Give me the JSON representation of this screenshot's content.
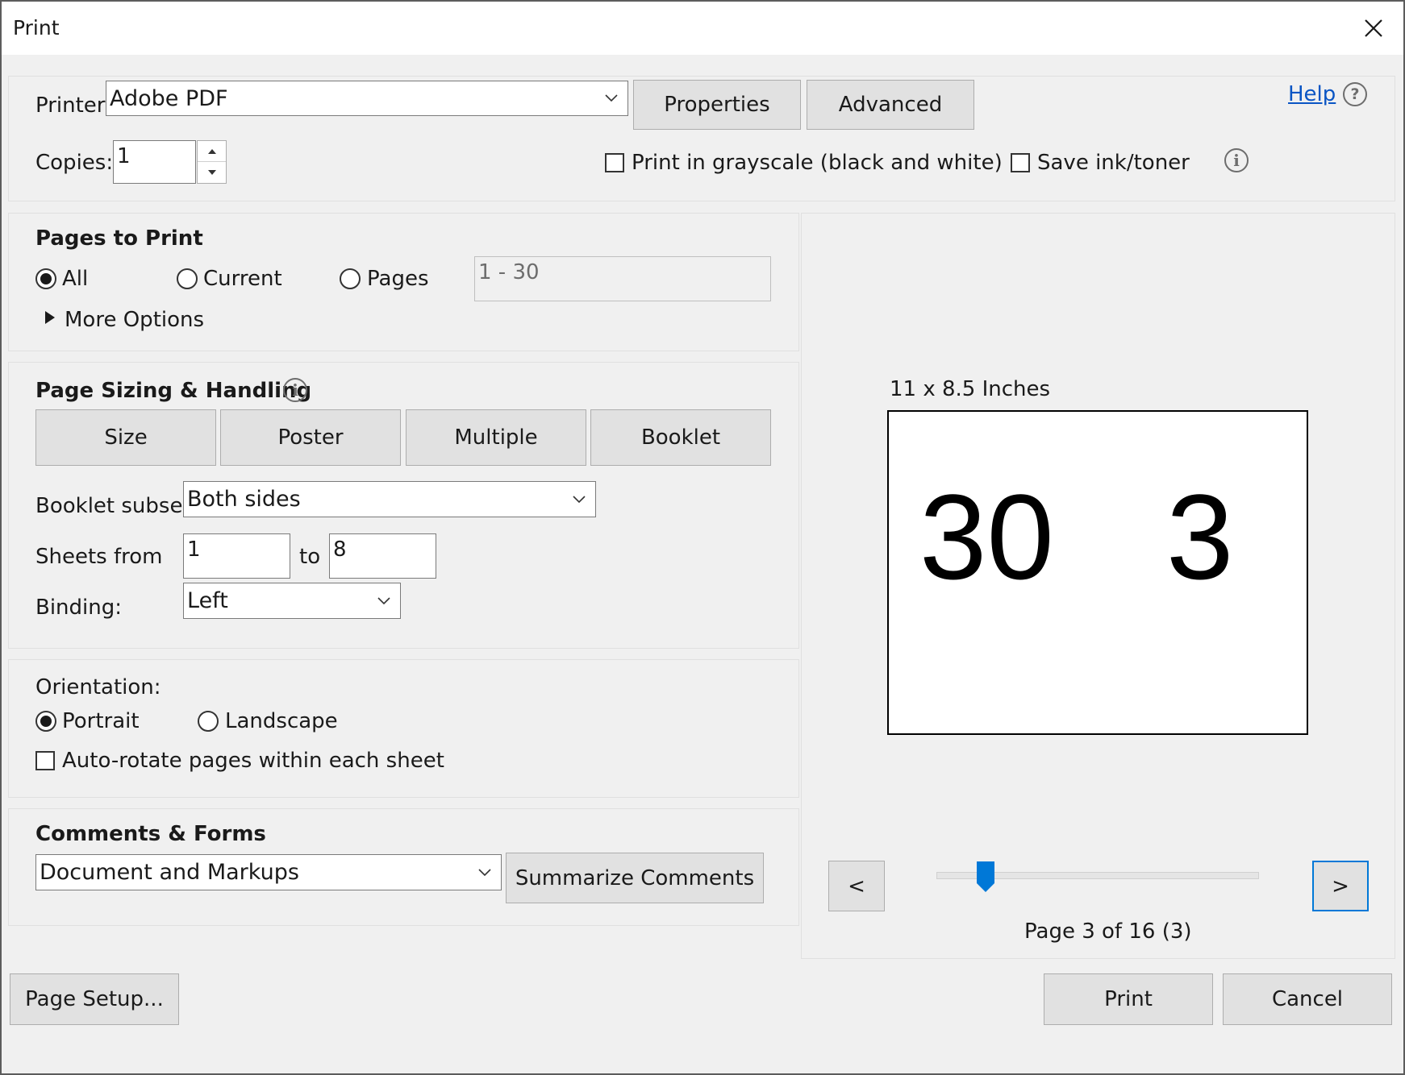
{
  "window": {
    "title": "Print",
    "close_icon": "close-icon"
  },
  "printer": {
    "label": "Printer:",
    "value": "Adobe PDF",
    "properties_label": "Properties",
    "advanced_label": "Advanced",
    "help_label": "Help",
    "copies_label": "Copies:",
    "copies_value": "1",
    "grayscale_label": "Print in grayscale (black and white)",
    "grayscale_checked": false,
    "save_ink_label": "Save ink/toner",
    "save_ink_checked": false
  },
  "pages_to_print": {
    "heading": "Pages to Print",
    "all_label": "All",
    "current_label": "Current",
    "pages_label": "Pages",
    "selected": "All",
    "pages_range_value": "1 - 30",
    "more_options_label": "More Options"
  },
  "page_sizing": {
    "heading": "Page Sizing & Handling",
    "tabs": [
      "Size",
      "Poster",
      "Multiple",
      "Booklet"
    ],
    "booklet_subset_label": "Booklet subset:",
    "booklet_subset_value": "Both sides",
    "sheets_from_label": "Sheets from",
    "sheets_from_value": "1",
    "to_label": "to",
    "sheets_to_value": "8",
    "binding_label": "Binding:",
    "binding_value": "Left"
  },
  "orientation": {
    "label": "Orientation:",
    "portrait_label": "Portrait",
    "landscape_label": "Landscape",
    "selected": "Portrait",
    "autorotate_label": "Auto-rotate pages within each sheet",
    "autorotate_checked": false
  },
  "comments_forms": {
    "heading": "Comments & Forms",
    "value": "Document and Markups",
    "summarize_label": "Summarize Comments"
  },
  "preview": {
    "size_label": "11 x 8.5 Inches",
    "left_number": "30",
    "right_number": "3",
    "prev_label": "<",
    "next_label": ">",
    "page_status": "Page 3 of 16 (3)",
    "current_page": 3,
    "total_pages": 16
  },
  "footer": {
    "page_setup_label": "Page Setup...",
    "print_label": "Print",
    "cancel_label": "Cancel"
  },
  "colors": {
    "accent": "#0078d7",
    "link": "#0a55c4"
  }
}
